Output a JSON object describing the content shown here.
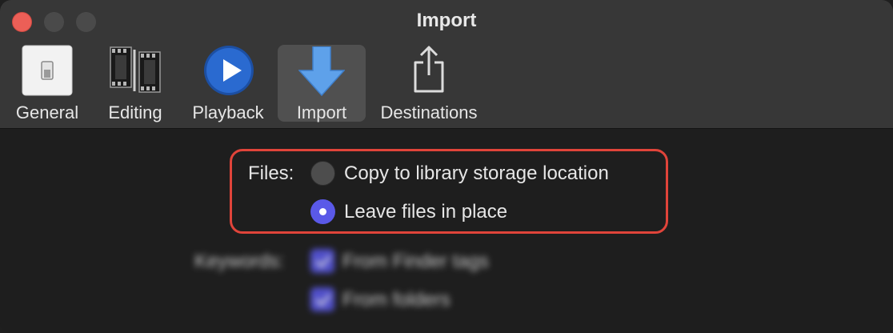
{
  "window": {
    "title": "Import",
    "controls": [
      "close",
      "minimize",
      "zoom"
    ]
  },
  "toolbar": {
    "tabs": [
      {
        "label": "General",
        "icon": "light-switch-icon",
        "selected": false
      },
      {
        "label": "Editing",
        "icon": "film-strip-icon",
        "selected": false
      },
      {
        "label": "Playback",
        "icon": "play-icon",
        "selected": false
      },
      {
        "label": "Import",
        "icon": "download-arrow-icon",
        "selected": true
      },
      {
        "label": "Destinations",
        "icon": "share-icon",
        "selected": false
      }
    ]
  },
  "files": {
    "label": "Files:",
    "options": [
      {
        "label": "Copy to library storage location",
        "selected": false
      },
      {
        "label": "Leave files in place",
        "selected": true
      }
    ]
  },
  "keywords": {
    "label": "Keywords:",
    "options": [
      {
        "label": "From Finder tags",
        "checked": true
      },
      {
        "label": "From folders",
        "checked": true
      }
    ]
  },
  "colors": {
    "accent": "#5a59e8",
    "highlight": "#e0443a",
    "toolbar_bg": "#373737",
    "content_bg": "#1e1e1e"
  }
}
